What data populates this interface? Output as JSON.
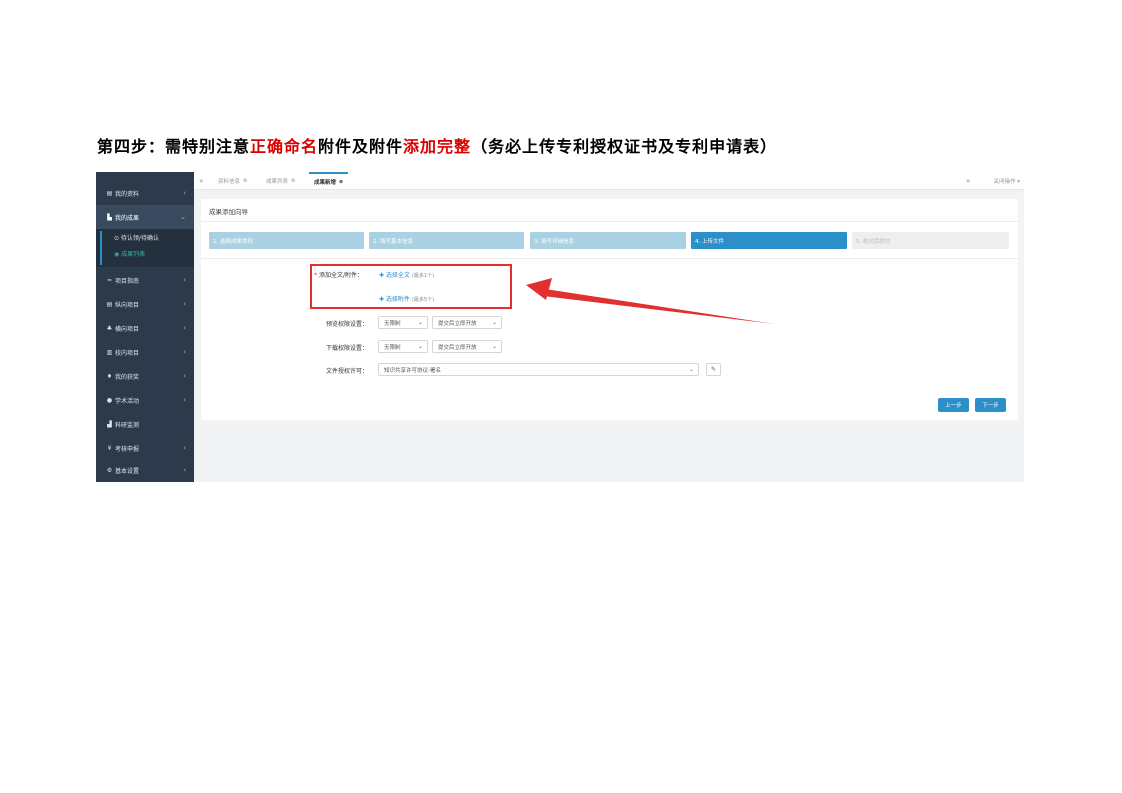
{
  "heading": {
    "part1": "第四步：需特别注意",
    "part2": "正确命名",
    "part3": "附件及附件",
    "part4": "添加完整",
    "part5": "（务必上传专利授权证书及专利申请表）"
  },
  "sidebar": {
    "items": [
      {
        "icon": "▤",
        "label": "我的资料"
      },
      {
        "icon": "▙",
        "label": "我的成果"
      },
      {
        "icon": "≈",
        "label": "项目指南"
      },
      {
        "icon": "▤",
        "label": "纵向项目"
      },
      {
        "icon": "♣",
        "label": "横向项目"
      },
      {
        "icon": "▥",
        "label": "校内项目"
      },
      {
        "icon": "♦",
        "label": "我的获奖"
      },
      {
        "icon": "●",
        "label": "学术活动"
      },
      {
        "icon": "▟",
        "label": "科研监测"
      },
      {
        "icon": "¥",
        "label": "考核申报"
      },
      {
        "icon": "⚙",
        "label": "基本设置"
      }
    ],
    "subitems": [
      {
        "label": "⊙ 待认领/待确认"
      },
      {
        "label": "◉ 成果列表"
      }
    ]
  },
  "tabs": [
    {
      "label": "资料信息"
    },
    {
      "label": "成果列表"
    },
    {
      "label": "成果新增"
    }
  ],
  "tab_nav": {
    "prev": "«",
    "next": "»",
    "close_ops": "关闭操作 ▾"
  },
  "panel": {
    "title": "成果添加向导",
    "steps": [
      "1. 选择成果类别",
      "2. 填写基本信息",
      "3. 填写详细信息",
      "4. 上传文件",
      "5. 核对后提交"
    ]
  },
  "form": {
    "attach_label": "添加全文/附件：",
    "pick_fulltext": "✚ 选择全文",
    "pick_fulltext_hint": "(最多1个)",
    "pick_attach": "✚ 选择附件",
    "pick_attach_hint": "(最多5个)",
    "preview_label": "预览权限设置：",
    "preview_value": "无限制",
    "preview_time": "提交后立即开放",
    "download_label": "下载权限设置：",
    "download_value": "无限制",
    "download_time": "提交后立即开放",
    "license_label": "文件授权许可：",
    "license_value": "知识共享许可协议-署名",
    "chev": "⌄",
    "edit_icon": "✎"
  },
  "buttons": {
    "prev": "上一步",
    "next": "下一步"
  },
  "colors": {
    "accent": "#2b8fc9",
    "sidebar": "#2d3a4b",
    "highlight": "#e23030",
    "heading_red": "#d80000"
  }
}
